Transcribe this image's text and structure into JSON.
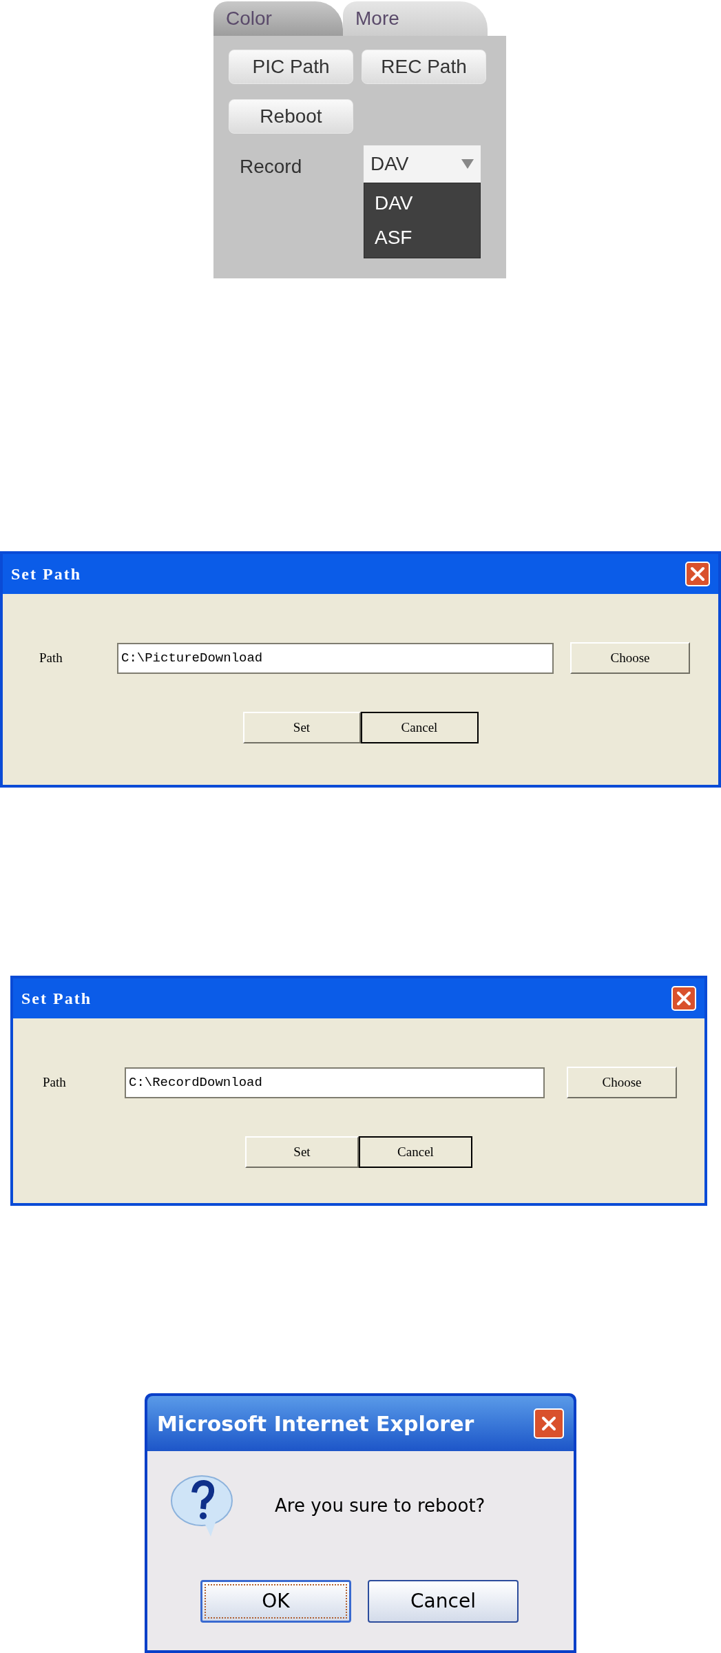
{
  "settings_panel": {
    "tabs": [
      {
        "label": "Color",
        "selected": false
      },
      {
        "label": "More",
        "selected": true
      }
    ],
    "buttons": [
      "PIC Path",
      "REC Path",
      "Reboot"
    ],
    "record": {
      "label": "Record",
      "value": "DAV",
      "options": [
        {
          "label": "DAV"
        },
        {
          "label": "ASF"
        }
      ]
    }
  },
  "dialogs": [
    {
      "title": "Set Path",
      "path_label": "Path",
      "path_value": "C:\\PictureDownload",
      "choose_button": "Choose",
      "buttons": [
        {
          "label": "Set",
          "focused": false
        },
        {
          "label": "Cancel",
          "focused": true
        }
      ]
    },
    {
      "title": "Set Path",
      "path_label": "Path",
      "path_value": "C:\\RecordDownload",
      "choose_button": "Choose",
      "buttons": [
        {
          "label": "Set",
          "focused": false
        },
        {
          "label": "Cancel",
          "focused": true
        }
      ]
    }
  ],
  "confirm_dialog": {
    "title": "Microsoft Internet Explorer",
    "message": "Are you sure to reboot?",
    "buttons": [
      {
        "label": "OK",
        "focused": true
      },
      {
        "label": "Cancel",
        "focused": false
      }
    ]
  }
}
